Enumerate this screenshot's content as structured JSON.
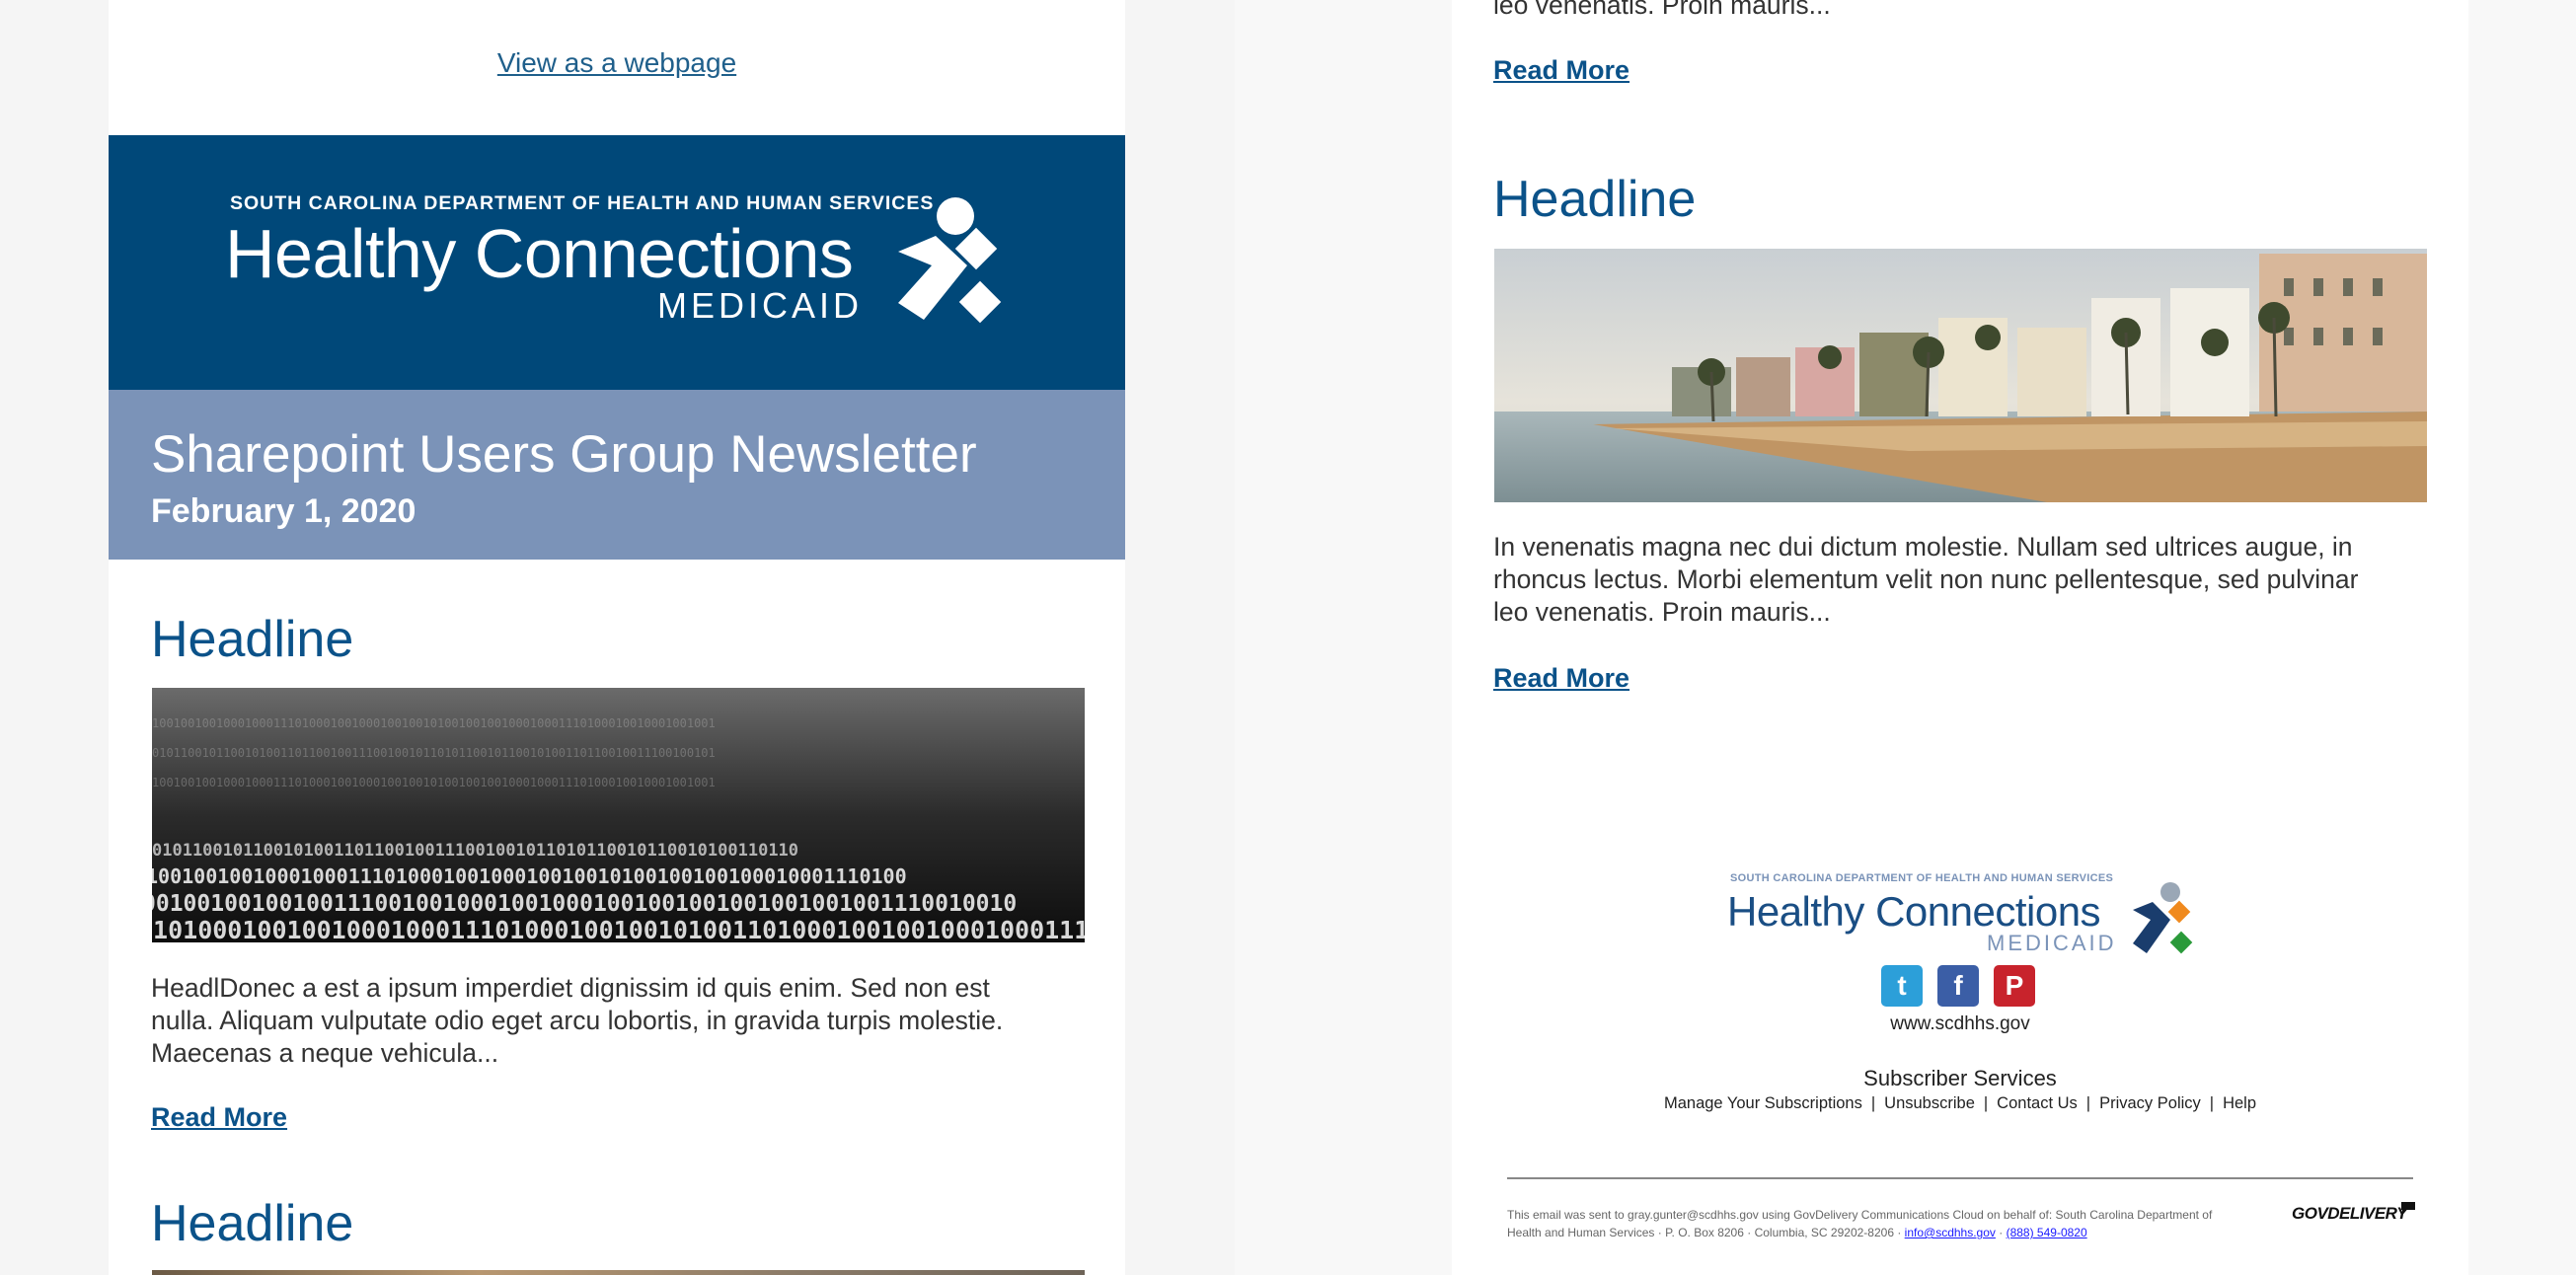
{
  "left": {
    "view_webpage": "View as a webpage",
    "logo": {
      "dept": "SOUTH CAROLINA DEPARTMENT OF HEALTH AND HUMAN SERVICES",
      "name": "Healthy Connections",
      "sub": "MEDICAID"
    },
    "newsletter_title": "Sharepoint Users Group Newsletter",
    "newsletter_date": "February 1, 2020",
    "articles": [
      {
        "headline": "Headline",
        "body_lines": [
          "HeadlDonec a est a ipsum imperdiet dignissim id quis enim. Sed non est",
          "nulla. Aliquam vulputate odio eget arcu lobortis, in gravida turpis molestie.",
          "Maecenas a neque vehicula..."
        ],
        "read_more": "Read More"
      },
      {
        "headline": "Headline"
      }
    ],
    "binary_rows": [
      "0101100101100101001101100100111001001011",
      "1001001001000100011101000100100010010010",
      "0010010010010011100100100010010001001001",
      "1101000100100100010001110100010010010100"
    ]
  },
  "right": {
    "partial_body": "leo venenatis. Proin mauris...",
    "read_more_1": "Read More",
    "article": {
      "headline": "Headline",
      "body_lines": [
        "In venenatis magna nec dui dictum molestie. Nullam sed ultrices augue, in",
        "rhoncus lectus. Morbi elementum velit non nunc pellentesque, sed pulvinar",
        "leo venenatis. Proin mauris..."
      ],
      "read_more": "Read More"
    },
    "footer": {
      "logo_dept": "SOUTH CAROLINA DEPARTMENT OF HEALTH AND HUMAN SERVICES",
      "logo_name": "Healthy Connections",
      "logo_sub": "MEDICAID",
      "social": [
        {
          "icon": "twitter-icon",
          "label": "t",
          "color": "#2c9fd9"
        },
        {
          "icon": "facebook-icon",
          "label": "f",
          "color": "#3b5ea6"
        },
        {
          "icon": "pinterest-icon",
          "label": "P",
          "color": "#c8232c"
        }
      ],
      "website": "www.scdhhs.gov",
      "subscriber_title": "Subscriber Services",
      "links": [
        "Manage Your Subscriptions",
        "Unsubscribe",
        "Contact Us",
        "Privacy Policy",
        "Help"
      ],
      "fine_print_1": "This email was sent to gray.gunter@scdhhs.gov using GovDelivery Communications Cloud on behalf of: South Carolina Department of",
      "fine_print_2": "Health and Human Services · P. O. Box 8206 · Columbia, SC 29202-8206 ·",
      "email_link": "info@scdhhs.gov",
      "phone_link": "(888) 549-0820",
      "govdelivery": "GOVDELIVERY"
    }
  },
  "colors": {
    "banner": "#004879",
    "title_band": "#7b93b8",
    "headline": "#0b5289",
    "link": "#1f5f8b"
  }
}
